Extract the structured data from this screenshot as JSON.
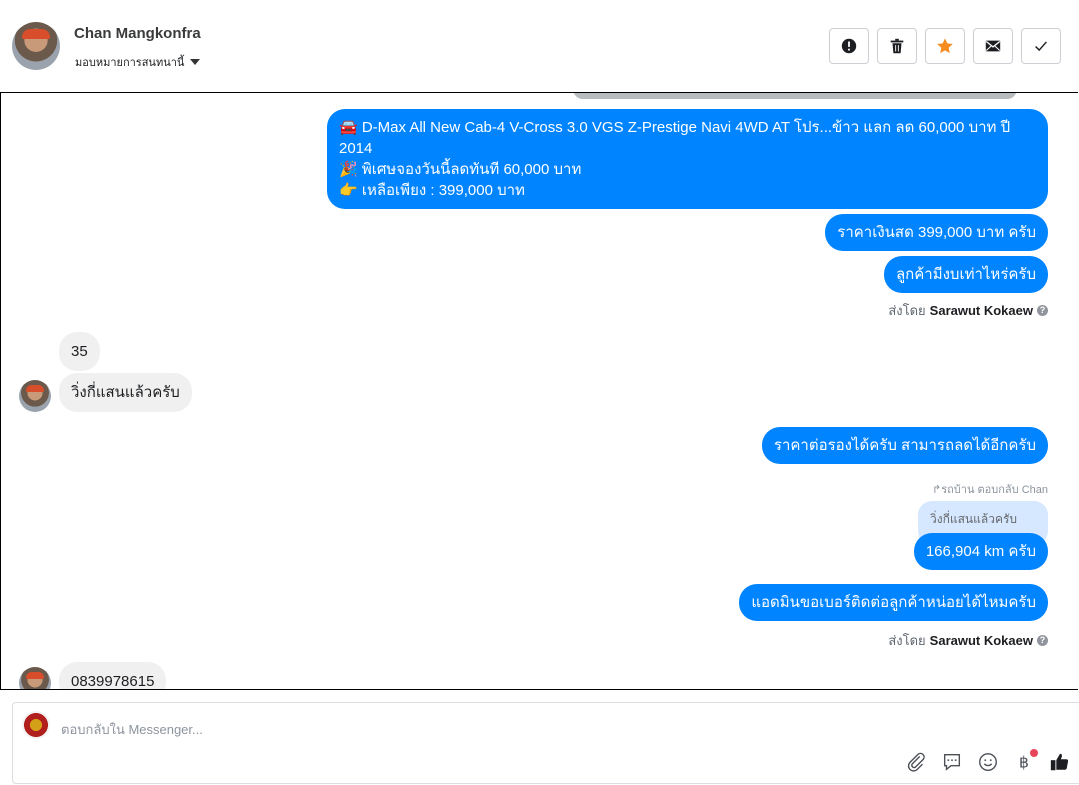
{
  "header": {
    "contact_name": "Chan Mangkonfra",
    "assign_label": "มอบหมายการสนทนานี้",
    "actions": [
      {
        "name": "mark-spam-button",
        "icon": "alert-icon"
      },
      {
        "name": "delete-button",
        "icon": "trash-icon"
      },
      {
        "name": "star-button",
        "icon": "star-icon"
      },
      {
        "name": "mark-unread-button",
        "icon": "envelope-icon"
      },
      {
        "name": "mark-done-button",
        "icon": "check-icon"
      }
    ],
    "accent_color": "#f68b1f"
  },
  "thread": {
    "brand_color": "#0084ff",
    "msg1": {
      "line1": "🚘 D-Max All New Cab-4 V-Cross 3.0 VGS Z-Prestige Navi 4WD AT โปร...ข้าว แลก ลด 60,000 บาท ปี 2014",
      "line2": "🎉 พิเศษจองวันนี้ลดทันที 60,000 บาท",
      "line3": "👉 เหลือเพียง : 399,000 บาท"
    },
    "msg2": "ราคาเงินสด 399,000 บาท ครับ",
    "msg3": "ลูกค้ามีงบเท่าไหร่ครับ",
    "sent_by_1": {
      "prefix": "ส่งโดย",
      "agent": "Sarawut Kokaew"
    },
    "in1": "35",
    "in2": "วิ่งกี่แสนแล้วครับ",
    "msg4": "ราคาต่อรองได้ครับ สามารถลดได้อีกครับ",
    "reply_meta": "↱รถบ้าน ตอบกลับ Chan",
    "quoted": "วิ่งกี่แสนแล้วครับ",
    "msg5": "166,904 km ครับ",
    "msg6": "แอดมินขอเบอร์ติดต่อลูกค้าหน่อยได้ไหมครับ",
    "sent_by_2": {
      "prefix": "ส่งโดย",
      "agent": "Sarawut Kokaew"
    },
    "in3": "0839978615"
  },
  "composer": {
    "placeholder": "ตอบกลับใน Messenger...",
    "tools": [
      "paperclip-icon",
      "saved-reply-icon",
      "emoji-icon",
      "baht-icon",
      "like-icon"
    ]
  }
}
